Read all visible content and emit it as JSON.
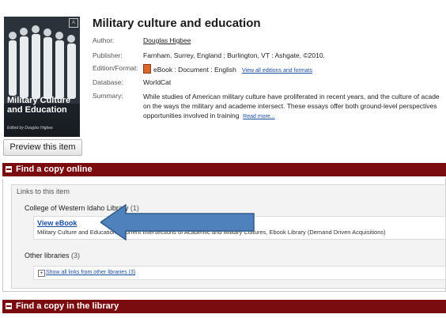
{
  "record": {
    "title": "Military culture and education",
    "author_label": "Author:",
    "author": "Douglas Higbee",
    "publisher_label": "Publisher:",
    "publisher": "Farnham, Surrey, England ; Burlington, VT : Ashgate, ©2010.",
    "format_label": "Edition/Format:",
    "format": "eBook : Document : English",
    "editions_link": "View all editions and formats",
    "database_label": "Database:",
    "database": "WorldCat",
    "summary_label": "Summary:",
    "summary_line1": "While studies of American military culture have proliferated in recent years, and the culture of acade",
    "summary_line2": "on the ways the military and academe intersect. These essays offer both ground-level perspectives",
    "summary_line3": "opportunities involved in training",
    "read_more": "Read more..."
  },
  "cover": {
    "title_line1": "Military Culture",
    "title_line2": "and Education",
    "byline": "Edited by Douglas Higbee",
    "badge": "A"
  },
  "preview_button": "Preview this item",
  "find_online": {
    "heading": "Find a copy online",
    "links_header": "Links to this item",
    "library_name": "College of Western Idaho Library",
    "library_count": "(1)",
    "ebook_link": "View eBook",
    "ebook_desc": "Military Culture and Education : Current Intersections of Academic and Military Cultures, Ebook Library (Demand Driven Acquisitions)",
    "other_libraries": "Other libraries",
    "other_count": "(3)",
    "show_all": "Show all links from other libraries (3)"
  },
  "find_library": {
    "heading": "Find a copy in the library"
  },
  "colors": {
    "section_bar": "#7a0b0f",
    "link": "#1a4ea1",
    "arrow": "#4f81bd"
  }
}
